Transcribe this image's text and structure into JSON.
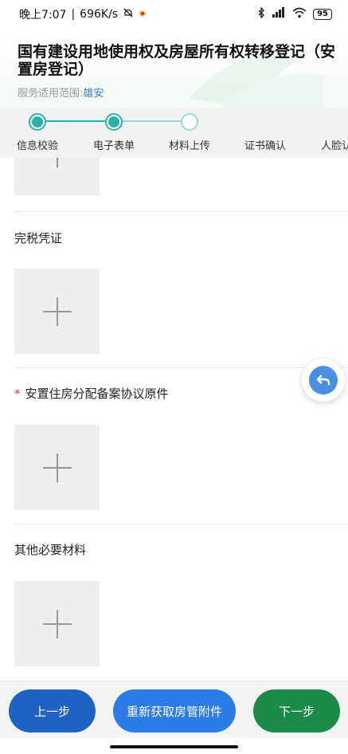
{
  "status_bar": {
    "time": "晚上7:07",
    "speed": "696K/s",
    "battery": "95"
  },
  "header": {
    "title": "国有建设用地使用权及房屋所有权转移登记（安置房登记）",
    "scope_label": "服务适用范围:",
    "scope_value": "雄安"
  },
  "steps": [
    {
      "label": "信息校验",
      "state": "done"
    },
    {
      "label": "电子表单",
      "state": "done"
    },
    {
      "label": "材料上传",
      "state": "current"
    },
    {
      "label": "证书确认",
      "state": "pending"
    },
    {
      "label": "人脸认",
      "state": "pending"
    }
  ],
  "sections": [
    {
      "label": "完税凭证",
      "required": false
    },
    {
      "label": "安置住房分配备案协议原件",
      "required": true,
      "required_mark": "*"
    },
    {
      "label": "其他必要材料",
      "required": false
    }
  ],
  "buttons": {
    "prev": "上一步",
    "refetch": "重新获取房管附件",
    "next": "下一步"
  },
  "colors": {
    "accent_teal": "#2bb3a8",
    "prev_button": "#1e63c4",
    "refetch_button": "#2d7be6",
    "next_button": "#1c8a48",
    "required": "#e4393c"
  }
}
